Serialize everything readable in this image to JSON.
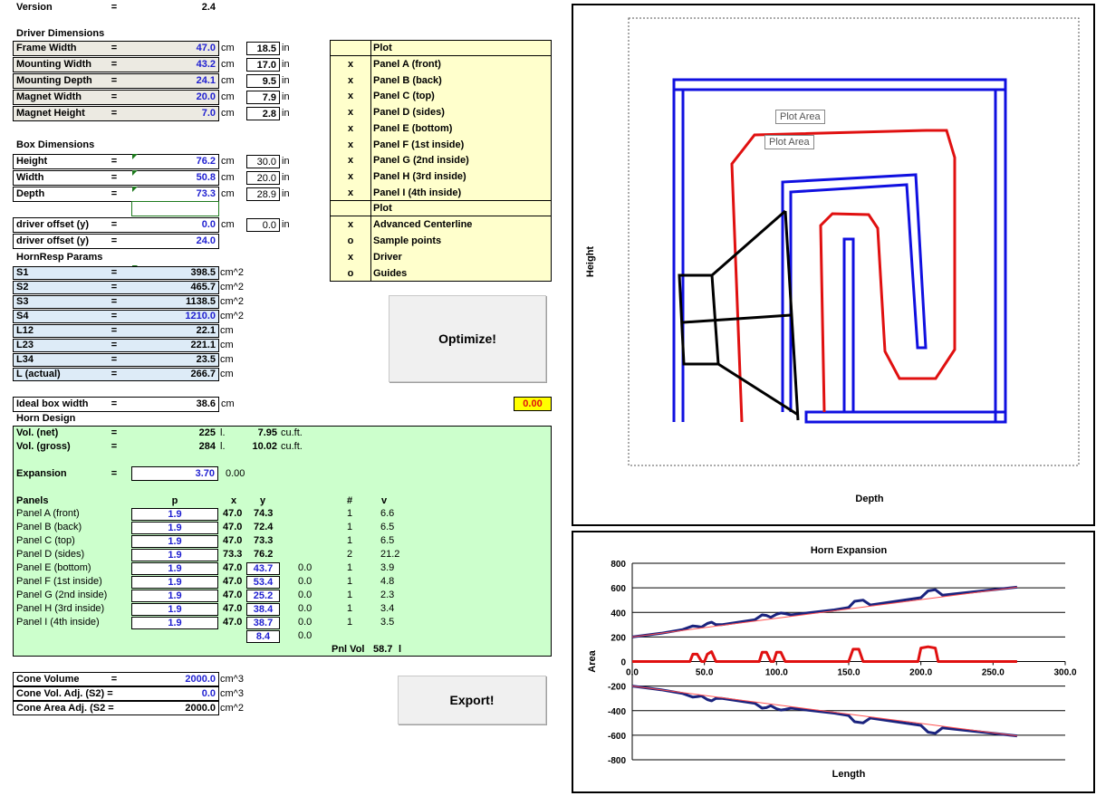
{
  "version": {
    "label": "Version",
    "eq": "=",
    "value": "2.4"
  },
  "driver": {
    "title": "Driver Dimensions",
    "rows": [
      {
        "label": "Frame Width",
        "value": "47.0",
        "unit": "cm",
        "in": "18.5",
        "in_unit": "in"
      },
      {
        "label": "Mounting Width",
        "value": "43.2",
        "unit": "cm",
        "in": "17.0",
        "in_unit": "in"
      },
      {
        "label": "Mounting Depth",
        "value": "24.1",
        "unit": "cm",
        "in": "9.5",
        "in_unit": "in"
      },
      {
        "label": "Magnet Width",
        "value": "20.0",
        "unit": "cm",
        "in": "7.9",
        "in_unit": "in"
      },
      {
        "label": "Magnet Height",
        "value": "7.0",
        "unit": "cm",
        "in": "2.8",
        "in_unit": "in"
      }
    ]
  },
  "box": {
    "title": "Box Dimensions",
    "rows": [
      {
        "label": "Height",
        "value": "76.2",
        "unit": "cm",
        "in": "30.0",
        "in_unit": "in"
      },
      {
        "label": "Width",
        "value": "50.8",
        "unit": "cm",
        "in": "20.0",
        "in_unit": "in"
      },
      {
        "label": "Depth",
        "value": "73.3",
        "unit": "cm",
        "in": "28.9",
        "in_unit": "in"
      }
    ],
    "offset1": {
      "label": "driver offset (y)",
      "value": "0.0",
      "unit": "cm",
      "in": "0.0",
      "in_unit": "in"
    },
    "offset2": {
      "label": "driver offset (y)",
      "value": "24.0"
    }
  },
  "hornresp": {
    "title": "HornResp Params",
    "rows": [
      {
        "label": "S1",
        "value": "398.5",
        "unit": "cm^2"
      },
      {
        "label": "S2",
        "value": "465.7",
        "unit": "cm^2"
      },
      {
        "label": "S3",
        "value": "1138.5",
        "unit": "cm^2"
      },
      {
        "label": "S4",
        "value": "1210.0",
        "unit": "cm^2"
      },
      {
        "label": "L12",
        "value": "22.1",
        "unit": "cm"
      },
      {
        "label": "L23",
        "value": "221.1",
        "unit": "cm"
      },
      {
        "label": "L34",
        "value": "23.5",
        "unit": "cm"
      },
      {
        "label": "L (actual)",
        "value": "266.7",
        "unit": "cm"
      }
    ]
  },
  "ideal": {
    "label": "Ideal box width",
    "value": "38.6",
    "unit": "cm",
    "indicator": "0.00"
  },
  "horn": {
    "title": "Horn Design",
    "vol_net": {
      "label": "Vol. (net)",
      "value": "225",
      "unit": "l.",
      "cuft": "7.95",
      "cuft_unit": "cu.ft."
    },
    "vol_gross": {
      "label": "Vol. (gross)",
      "value": "284",
      "unit": "l.",
      "cuft": "10.02",
      "cuft_unit": "cu.ft."
    },
    "expansion": {
      "label": "Expansion",
      "value": "3.70",
      "extra": "0.00"
    },
    "headers": {
      "panels": "Panels",
      "p": "p",
      "x": "x",
      "y": "y",
      "n": "#",
      "v": "v"
    },
    "panels": [
      {
        "name": "Panel A (front)",
        "p": "1.9",
        "x": "47.0",
        "y": "74.3",
        "z": "",
        "n": "1",
        "v": "6.6",
        "yboxed": false
      },
      {
        "name": "Panel B (back)",
        "p": "1.9",
        "x": "47.0",
        "y": "72.4",
        "z": "",
        "n": "1",
        "v": "6.5",
        "yboxed": false
      },
      {
        "name": "Panel C (top)",
        "p": "1.9",
        "x": "47.0",
        "y": "73.3",
        "z": "",
        "n": "1",
        "v": "6.5",
        "yboxed": false
      },
      {
        "name": "Panel D (sides)",
        "p": "1.9",
        "x": "73.3",
        "y": "76.2",
        "z": "",
        "n": "2",
        "v": "21.2",
        "yboxed": false
      },
      {
        "name": "Panel E (bottom)",
        "p": "1.9",
        "x": "47.0",
        "y": "43.7",
        "z": "0.0",
        "n": "1",
        "v": "3.9",
        "yboxed": true
      },
      {
        "name": "Panel F (1st inside)",
        "p": "1.9",
        "x": "47.0",
        "y": "53.4",
        "z": "0.0",
        "n": "1",
        "v": "4.8",
        "yboxed": true
      },
      {
        "name": "Panel G (2nd inside)",
        "p": "1.9",
        "x": "47.0",
        "y": "25.2",
        "z": "0.0",
        "n": "1",
        "v": "2.3",
        "yboxed": true
      },
      {
        "name": "Panel H (3rd inside)",
        "p": "1.9",
        "x": "47.0",
        "y": "38.4",
        "z": "0.0",
        "n": "1",
        "v": "3.4",
        "yboxed": true
      },
      {
        "name": "Panel I (4th inside)",
        "p": "1.9",
        "x": "47.0",
        "y": "38.7",
        "z": "0.0",
        "n": "1",
        "v": "3.5",
        "yboxed": true
      }
    ],
    "extra_row": {
      "y": "8.4",
      "z": "0.0"
    },
    "pnl_vol": {
      "label": "Pnl Vol",
      "value": "58.7",
      "unit": "l"
    }
  },
  "cone": {
    "rows": [
      {
        "label": "Cone Volume",
        "eq": "=",
        "value": "2000.0",
        "unit": "cm^3",
        "blue": true
      },
      {
        "label": "Cone Vol. Adj. (S2) =",
        "eq": "",
        "value": "0.0",
        "unit": "cm^3",
        "blue": true
      },
      {
        "label": "Cone Area Adj. (S2 =",
        "eq": "",
        "value": "2000.0",
        "unit": "cm^2",
        "blue": false
      }
    ]
  },
  "plot_panel": {
    "header": "Plot",
    "rows": [
      {
        "mark": "x",
        "label": "Panel A (front)"
      },
      {
        "mark": "x",
        "label": "Panel B (back)"
      },
      {
        "mark": "x",
        "label": "Panel C (top)"
      },
      {
        "mark": "x",
        "label": "Panel D (sides)"
      },
      {
        "mark": "x",
        "label": "Panel E (bottom)"
      },
      {
        "mark": "x",
        "label": "Panel F (1st inside)"
      },
      {
        "mark": "x",
        "label": "Panel G (2nd inside)"
      },
      {
        "mark": "x",
        "label": "Panel H (3rd inside)"
      },
      {
        "mark": "x",
        "label": "Panel I (4th inside)"
      }
    ],
    "header2": "Plot",
    "rows2": [
      {
        "mark": "x",
        "label": "Advanced Centerline"
      },
      {
        "mark": "o",
        "label": "Sample points"
      },
      {
        "mark": "x",
        "label": "Driver"
      },
      {
        "mark": "o",
        "label": "Guides"
      }
    ]
  },
  "buttons": {
    "optimize": "Optimize!",
    "export": "Export!"
  },
  "diagram": {
    "xlabel": "Depth",
    "ylabel": "Height",
    "tooltip1": "Plot Area",
    "tooltip2": "Plot Area",
    "colors": {
      "panels": "#1010e0",
      "centerline": "#e01010",
      "driver": "#000000"
    }
  },
  "chart_data": {
    "type": "line",
    "title": "Horn Expansion",
    "xlabel": "Length",
    "ylabel": "Area",
    "xlim": [
      0,
      300
    ],
    "ylim": [
      -800,
      800
    ],
    "xticks": [
      "0.0",
      "50.0",
      "100.0",
      "150.0",
      "200.0",
      "250.0",
      "300.0"
    ],
    "yticks": [
      "800",
      "600",
      "400",
      "200",
      "0",
      "-200",
      "-400",
      "-600",
      "-800"
    ],
    "series": [
      {
        "color": "#1a237e",
        "x": [
          0,
          20,
          35,
          42,
          45,
          48,
          52,
          55,
          58,
          62,
          85,
          90,
          93,
          96,
          100,
          103,
          106,
          110,
          140,
          150,
          154,
          160,
          165,
          200,
          205,
          210,
          215,
          266.7
        ],
        "y": [
          200,
          230,
          260,
          290,
          285,
          280,
          310,
          320,
          300,
          300,
          340,
          380,
          375,
          360,
          385,
          395,
          390,
          380,
          420,
          440,
          490,
          500,
          460,
          520,
          575,
          585,
          540,
          605
        ]
      },
      {
        "color": "#1a237e",
        "x": [
          0,
          20,
          35,
          42,
          45,
          48,
          52,
          55,
          58,
          62,
          85,
          90,
          93,
          96,
          100,
          103,
          106,
          110,
          140,
          150,
          154,
          160,
          165,
          200,
          205,
          210,
          215,
          266.7
        ],
        "y": [
          -200,
          -230,
          -260,
          -290,
          -285,
          -280,
          -310,
          -320,
          -300,
          -300,
          -340,
          -380,
          -375,
          -360,
          -385,
          -395,
          -390,
          -380,
          -420,
          -440,
          -490,
          -500,
          -460,
          -520,
          -575,
          -585,
          -540,
          -605
        ]
      },
      {
        "color": "#e01010",
        "x": [
          0,
          40,
          42,
          45,
          48,
          50,
          52,
          55,
          58,
          88,
          90,
          93,
          96,
          98,
          100,
          103,
          106,
          108,
          150,
          153,
          157,
          160,
          198,
          200,
          205,
          210,
          212,
          266.7
        ],
        "y": [
          0,
          0,
          60,
          60,
          0,
          0,
          60,
          80,
          0,
          0,
          75,
          75,
          0,
          0,
          75,
          75,
          0,
          0,
          0,
          100,
          100,
          0,
          0,
          110,
          120,
          110,
          0,
          0
        ]
      },
      {
        "color": "#ff5050",
        "x": [
          0,
          266.7
        ],
        "y": [
          200,
          605
        ]
      },
      {
        "color": "#ff5050",
        "x": [
          0,
          266.7
        ],
        "y": [
          -200,
          -605
        ]
      }
    ]
  }
}
